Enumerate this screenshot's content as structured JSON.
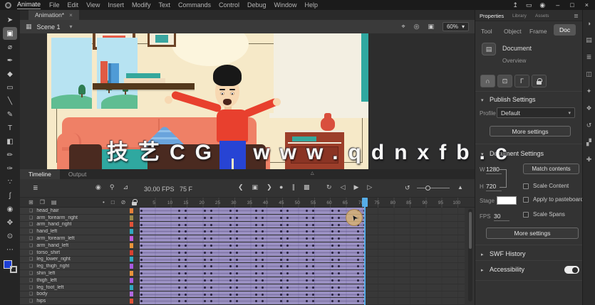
{
  "menubar": {
    "app": "Animate",
    "items": [
      "File",
      "Edit",
      "View",
      "Insert",
      "Modify",
      "Text",
      "Commands",
      "Control",
      "Debug",
      "Window",
      "Help"
    ],
    "share_icon": "↥",
    "display_icon": "▭",
    "record_icon": "◉",
    "minimize": "–",
    "maximize": "□",
    "close": "×"
  },
  "doc_tab": {
    "title": "Animation*",
    "close_icon": "×"
  },
  "edit_bar": {
    "back_icon": "▦",
    "scene": "Scene 1",
    "chevron": "▾",
    "center_icon": "⌖",
    "symbols_icon": "◎",
    "fit_icon": "▣",
    "zoom": "60%",
    "zoom_chevron": "▾"
  },
  "toolbar": {
    "fill_color": "#1d3fd6",
    "tools": [
      {
        "name": "selection",
        "glyph": "➤"
      },
      {
        "name": "free-transform",
        "glyph": "▣",
        "active": true
      },
      {
        "name": "lasso",
        "glyph": "⌀"
      },
      {
        "name": "pen",
        "glyph": "✒"
      },
      {
        "name": "eraser",
        "glyph": "◆"
      },
      {
        "name": "rectangle",
        "glyph": "▭"
      },
      {
        "name": "line",
        "glyph": "╲"
      },
      {
        "name": "brush",
        "glyph": "✎"
      },
      {
        "name": "text",
        "glyph": "T"
      },
      {
        "name": "gradient",
        "glyph": "◧"
      },
      {
        "name": "pencil",
        "glyph": "✏"
      },
      {
        "name": "pin",
        "glyph": "✑"
      },
      {
        "name": "spray",
        "glyph": "∵"
      },
      {
        "name": "bone",
        "glyph": "ʃ"
      },
      {
        "name": "camera",
        "glyph": "◉"
      },
      {
        "name": "hand",
        "glyph": "✥"
      },
      {
        "name": "zoom",
        "glyph": "⊙"
      },
      {
        "name": "more-tools",
        "glyph": "⋯"
      }
    ]
  },
  "stage": {
    "watermark": "技艺CG www.qdnxfb.c"
  },
  "timeline": {
    "tabs": [
      "Timeline",
      "Output"
    ],
    "layers_icon": "≣",
    "mid_icons": [
      {
        "name": "camera",
        "glyph": "◉"
      },
      {
        "name": "parenting-view",
        "glyph": "⚲"
      },
      {
        "name": "graph-editor",
        "glyph": "⊿"
      }
    ],
    "fps_label": "30.00 FPS",
    "frame_label": "75 F",
    "nav_icons": [
      {
        "name": "prev-keyframe",
        "glyph": "❮"
      },
      {
        "name": "center-frame",
        "glyph": "▣"
      },
      {
        "name": "next-keyframe",
        "glyph": "❯"
      }
    ],
    "onion_icons": [
      {
        "name": "onion-skin",
        "glyph": "●"
      },
      {
        "name": "onion-outlines",
        "glyph": "∥"
      },
      {
        "name": "edit-multiple-frames",
        "glyph": "▩"
      }
    ],
    "play_icons": [
      {
        "name": "loop",
        "glyph": "↻"
      },
      {
        "name": "step-back",
        "glyph": "◁"
      },
      {
        "name": "play",
        "glyph": "▶"
      },
      {
        "name": "step-forward",
        "glyph": "▷"
      }
    ],
    "reset_icon": "↺",
    "resize_icon": "▲",
    "marker": "△",
    "header_left_icons": [
      {
        "name": "add-layer",
        "glyph": "⊞"
      },
      {
        "name": "add-folder",
        "glyph": "❐"
      },
      {
        "name": "delete-layer",
        "glyph": "▤"
      }
    ],
    "header_right_icons": [
      {
        "name": "show-all",
        "glyph": "•"
      },
      {
        "name": "outline-mode",
        "glyph": "□"
      },
      {
        "name": "hide-all",
        "glyph": "⊘"
      },
      {
        "name": "lock-all",
        "glyph": "css-lock"
      }
    ],
    "layers": [
      {
        "name": "head_hair",
        "color": "#e8803a"
      },
      {
        "name": "arm_forearm_right",
        "color": "#9a8a4a"
      },
      {
        "name": "arm_hand_right",
        "color": "#e05238"
      },
      {
        "name": "hand_left",
        "color": "#30a8c0"
      },
      {
        "name": "arm_forearm_left",
        "color": "#c05ae0"
      },
      {
        "name": "arm_hand_left",
        "color": "#e8943a"
      },
      {
        "name": "torso_shirt",
        "color": "#d84030"
      },
      {
        "name": "leg_lower_right",
        "color": "#30a8c0"
      },
      {
        "name": "leg_thigh_right",
        "color": "#a85ae0"
      },
      {
        "name": "shin_left",
        "color": "#e8943a"
      },
      {
        "name": "thigh_left",
        "color": "#a85ae0"
      },
      {
        "name": "leg_foot_left",
        "color": "#30a8c0"
      },
      {
        "name": "body",
        "color": "#b06ae0"
      },
      {
        "name": "hips",
        "color": "#e05238"
      }
    ],
    "ruler_numbers": [
      5,
      10,
      15,
      20,
      25,
      30,
      35,
      40,
      45,
      50,
      55,
      60,
      65,
      70,
      75,
      80,
      85,
      90,
      95,
      100
    ],
    "keyframes": [
      1,
      13,
      15,
      21,
      23,
      29,
      31,
      37,
      39,
      45,
      47,
      53,
      55,
      61,
      63,
      69,
      71
    ],
    "playhead_frame": 71
  },
  "properties": {
    "panel_tabs": [
      "Properties",
      "Library",
      "Assets"
    ],
    "panel_menu_icon": "≣",
    "mode_tabs": [
      "Tool",
      "Object",
      "Frame",
      "Doc"
    ],
    "active_mode_tab": "Doc",
    "document": {
      "icon": "▤",
      "title": "Document",
      "subtitle": "Overview"
    },
    "snap_buttons": [
      {
        "name": "snap-to-objects",
        "glyph": "∩",
        "state": "active"
      },
      {
        "name": "snap-align",
        "glyph": "⊡",
        "state": "semi"
      },
      {
        "name": "snap-to-grid",
        "glyph": "Γ",
        "state": ""
      },
      {
        "name": "lock-guides",
        "glyph": "css-lock",
        "state": ""
      }
    ],
    "publish": {
      "header": "Publish Settings",
      "profile_label": "Profile",
      "profile_value": "Default",
      "more_button": "More settings"
    },
    "doc_settings": {
      "header": "Document Settings",
      "w_label": "W",
      "w_value": "1280",
      "h_label": "H",
      "h_value": "720",
      "stage_label": "Stage",
      "stage_color": "#ffffff",
      "fps_label": "FPS",
      "fps_value": "30",
      "match_button": "Match contents",
      "checkboxes": [
        "Scale Content",
        "Apply to pasteboard",
        "Scale Spans"
      ],
      "more_button": "More settings"
    },
    "swf_history": "SWF History",
    "accessibility": {
      "label": "Accessibility",
      "enabled": true
    }
  },
  "dock_icons": [
    {
      "name": "color",
      "glyph": "◑"
    },
    {
      "name": "swatches",
      "glyph": "▤"
    },
    {
      "name": "align",
      "glyph": "≣"
    },
    {
      "name": "libraries",
      "glyph": "◫"
    },
    {
      "name": "brushes",
      "glyph": "✦"
    },
    {
      "name": "components",
      "glyph": "❖"
    },
    {
      "name": "history",
      "glyph": "↺"
    },
    {
      "name": "info",
      "glyph": "▞"
    },
    {
      "name": "add-panel",
      "glyph": "✚"
    }
  ],
  "palette": {
    "accent_blue": "#56ade8",
    "tween_purple": "#9a90c2",
    "panel_dark": "#333333",
    "stage_cream": "#f6e9c8",
    "couch_coral": "#ef8066",
    "teal": "#2fa8a0",
    "shirt_red": "#e8402e",
    "jeans_blue": "#2744d4",
    "sky_blue": "#b7e3f2",
    "table_rust": "#9c3e2a"
  }
}
